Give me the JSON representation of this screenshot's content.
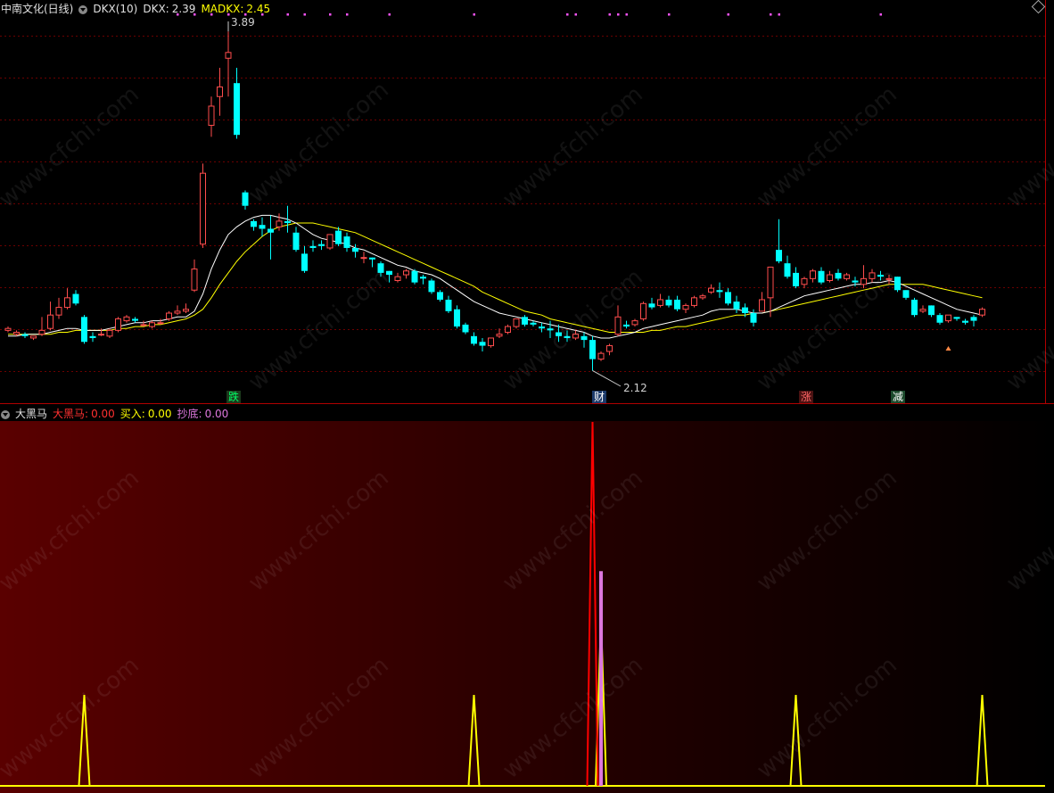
{
  "header": {
    "stock_name": "中南文化(日线)",
    "indicator_name": "DKX(10)",
    "dkx_label": "DKX:",
    "dkx_value": "2.39",
    "madkx_label": "MADKX:",
    "madkx_value": "2.45"
  },
  "price_annotations": {
    "high": "3.89",
    "low": "2.12"
  },
  "signal_tags": {
    "die": "跌",
    "cai": "财",
    "zhang": "涨",
    "jian": "减"
  },
  "sub_header": {
    "indicator_name": "大黑马",
    "dahema_label": "大黑马:",
    "dahema_value": "0.00",
    "mairu_label": "买入:",
    "mairu_value": "0.00",
    "chaodi_label": "抄底:",
    "chaodi_value": "0.00"
  },
  "watermark": "www.cfchi.com",
  "colors": {
    "up": "#ff4d4d",
    "down": "#00ffff",
    "dkx_line": "#ffffff",
    "madkx_line": "#ffff00",
    "dahema": "#ff0000",
    "mairu": "#ffff00",
    "chaodi": "#dd77dd",
    "grid": "#6b0000"
  },
  "chart_data": {
    "type": "candlestick",
    "candles": [
      [
        2.33,
        2.35,
        2.34,
        2.32
      ],
      [
        2.31,
        2.33,
        2.32,
        2.3
      ],
      [
        2.31,
        2.32,
        2.3,
        2.29
      ],
      [
        2.29,
        2.3,
        2.3,
        2.28
      ],
      [
        2.31,
        2.4,
        2.33,
        2.3
      ],
      [
        2.34,
        2.48,
        2.41,
        2.33
      ],
      [
        2.41,
        2.5,
        2.45,
        2.39
      ],
      [
        2.45,
        2.55,
        2.5,
        2.44
      ],
      [
        2.52,
        2.54,
        2.47,
        2.46
      ],
      [
        2.4,
        2.41,
        2.27,
        2.26
      ],
      [
        2.3,
        2.32,
        2.29,
        2.27
      ],
      [
        2.31,
        2.34,
        2.31,
        2.3
      ],
      [
        2.3,
        2.34,
        2.33,
        2.29
      ],
      [
        2.33,
        2.4,
        2.39,
        2.32
      ],
      [
        2.38,
        2.41,
        2.4,
        2.37
      ],
      [
        2.39,
        2.4,
        2.38,
        2.37
      ],
      [
        2.36,
        2.38,
        2.36,
        2.35
      ],
      [
        2.35,
        2.38,
        2.37,
        2.34
      ],
      [
        2.37,
        2.39,
        2.37,
        2.36
      ],
      [
        2.39,
        2.43,
        2.42,
        2.38
      ],
      [
        2.42,
        2.46,
        2.43,
        2.41
      ],
      [
        2.43,
        2.47,
        2.44,
        2.42
      ],
      [
        2.54,
        2.7,
        2.65,
        2.53
      ],
      [
        2.78,
        3.2,
        3.15,
        2.76
      ],
      [
        3.4,
        3.55,
        3.5,
        3.34
      ],
      [
        3.55,
        3.7,
        3.6,
        3.45
      ],
      [
        3.75,
        3.89,
        3.78,
        3.55
      ],
      [
        3.62,
        3.7,
        3.35,
        3.33
      ],
      [
        3.05,
        3.06,
        2.98,
        2.96
      ],
      [
        2.9,
        2.91,
        2.87,
        2.85
      ],
      [
        2.88,
        2.92,
        2.86,
        2.82
      ],
      [
        2.86,
        2.93,
        2.84,
        2.7
      ],
      [
        2.87,
        2.94,
        2.9,
        2.85
      ],
      [
        2.9,
        2.98,
        2.89,
        2.84
      ],
      [
        2.84,
        2.87,
        2.75,
        2.74
      ],
      [
        2.73,
        2.77,
        2.64,
        2.63
      ],
      [
        2.77,
        2.8,
        2.76,
        2.74
      ],
      [
        2.78,
        2.8,
        2.77,
        2.75
      ],
      [
        2.76,
        2.8,
        2.83,
        2.75
      ],
      [
        2.85,
        2.87,
        2.78,
        2.77
      ],
      [
        2.82,
        2.84,
        2.76,
        2.74
      ],
      [
        2.76,
        2.78,
        2.74,
        2.71
      ],
      [
        2.71,
        2.74,
        2.71,
        2.68
      ],
      [
        2.71,
        2.7,
        2.7,
        2.66
      ],
      [
        2.68,
        2.69,
        2.63,
        2.61
      ],
      [
        2.64,
        2.62,
        2.62,
        2.58
      ],
      [
        2.59,
        2.63,
        2.61,
        2.58
      ],
      [
        2.62,
        2.65,
        2.64,
        2.6
      ],
      [
        2.64,
        2.65,
        2.58,
        2.57
      ],
      [
        2.61,
        2.62,
        2.6,
        2.57
      ],
      [
        2.59,
        2.6,
        2.53,
        2.52
      ],
      [
        2.53,
        2.54,
        2.49,
        2.48
      ],
      [
        2.49,
        2.51,
        2.43,
        2.42
      ],
      [
        2.44,
        2.46,
        2.35,
        2.34
      ],
      [
        2.36,
        2.37,
        2.32,
        2.31
      ],
      [
        2.3,
        2.32,
        2.26,
        2.25
      ],
      [
        2.27,
        2.29,
        2.25,
        2.22
      ],
      [
        2.25,
        2.29,
        2.29,
        2.24
      ],
      [
        2.3,
        2.34,
        2.31,
        2.29
      ],
      [
        2.32,
        2.36,
        2.35,
        2.31
      ],
      [
        2.35,
        2.38,
        2.39,
        2.34
      ],
      [
        2.4,
        2.41,
        2.36,
        2.35
      ],
      [
        2.37,
        2.38,
        2.36,
        2.35
      ],
      [
        2.35,
        2.37,
        2.34,
        2.32
      ],
      [
        2.34,
        2.38,
        2.33,
        2.29
      ],
      [
        2.32,
        2.36,
        2.3,
        2.27
      ],
      [
        2.3,
        2.33,
        2.29,
        2.27
      ],
      [
        2.29,
        2.33,
        2.31,
        2.28
      ],
      [
        2.3,
        2.32,
        2.28,
        2.24
      ],
      [
        2.28,
        2.3,
        2.18,
        2.12
      ],
      [
        2.18,
        2.22,
        2.21,
        2.17
      ],
      [
        2.22,
        2.26,
        2.25,
        2.2
      ],
      [
        2.31,
        2.46,
        2.4,
        2.3
      ],
      [
        2.36,
        2.38,
        2.35,
        2.34
      ],
      [
        2.36,
        2.39,
        2.38,
        2.35
      ],
      [
        2.39,
        2.48,
        2.47,
        2.38
      ],
      [
        2.47,
        2.5,
        2.45,
        2.44
      ],
      [
        2.46,
        2.52,
        2.49,
        2.45
      ],
      [
        2.49,
        2.51,
        2.46,
        2.45
      ],
      [
        2.49,
        2.51,
        2.44,
        2.43
      ],
      [
        2.44,
        2.47,
        2.46,
        2.42
      ],
      [
        2.46,
        2.51,
        2.5,
        2.45
      ],
      [
        2.5,
        2.52,
        2.51,
        2.49
      ],
      [
        2.53,
        2.57,
        2.55,
        2.52
      ],
      [
        2.54,
        2.58,
        2.53,
        2.5
      ],
      [
        2.53,
        2.55,
        2.47,
        2.46
      ],
      [
        2.48,
        2.51,
        2.44,
        2.42
      ],
      [
        2.45,
        2.47,
        2.42,
        2.4
      ],
      [
        2.42,
        2.44,
        2.37,
        2.35
      ],
      [
        2.43,
        2.53,
        2.49,
        2.43
      ],
      [
        2.5,
        2.65,
        2.66,
        2.4
      ],
      [
        2.75,
        2.91,
        2.69,
        2.68
      ],
      [
        2.68,
        2.72,
        2.61,
        2.6
      ],
      [
        2.63,
        2.66,
        2.56,
        2.55
      ],
      [
        2.57,
        2.61,
        2.6,
        2.55
      ],
      [
        2.6,
        2.65,
        2.64,
        2.58
      ],
      [
        2.64,
        2.66,
        2.58,
        2.57
      ],
      [
        2.59,
        2.64,
        2.62,
        2.58
      ],
      [
        2.63,
        2.65,
        2.6,
        2.59
      ],
      [
        2.6,
        2.63,
        2.62,
        2.59
      ],
      [
        2.59,
        2.61,
        2.58,
        2.56
      ],
      [
        2.57,
        2.67,
        2.6,
        2.55
      ],
      [
        2.6,
        2.65,
        2.63,
        2.58
      ],
      [
        2.62,
        2.64,
        2.61,
        2.59
      ],
      [
        2.6,
        2.62,
        2.6,
        2.57
      ],
      [
        2.61,
        2.58,
        2.54,
        2.53
      ],
      [
        2.54,
        2.53,
        2.5,
        2.49
      ],
      [
        2.49,
        2.5,
        2.41,
        2.4
      ],
      [
        2.43,
        2.46,
        2.44,
        2.42
      ],
      [
        2.46,
        2.45,
        2.41,
        2.4
      ],
      [
        2.41,
        2.42,
        2.37,
        2.36
      ],
      [
        2.38,
        2.4,
        2.41,
        2.37
      ],
      [
        2.4,
        2.4,
        2.39,
        2.38
      ],
      [
        2.38,
        2.39,
        2.37,
        2.36
      ],
      [
        2.4,
        2.41,
        2.38,
        2.35
      ],
      [
        2.41,
        2.45,
        2.44,
        2.4
      ]
    ],
    "dkx": [
      2.3,
      2.3,
      2.31,
      2.31,
      2.31,
      2.32,
      2.33,
      2.34,
      2.34,
      2.33,
      2.33,
      2.33,
      2.34,
      2.35,
      2.36,
      2.37,
      2.37,
      2.38,
      2.38,
      2.39,
      2.4,
      2.4,
      2.43,
      2.52,
      2.65,
      2.75,
      2.83,
      2.87,
      2.9,
      2.92,
      2.93,
      2.93,
      2.92,
      2.91,
      2.89,
      2.86,
      2.83,
      2.81,
      2.8,
      2.79,
      2.78,
      2.76,
      2.75,
      2.73,
      2.71,
      2.69,
      2.67,
      2.66,
      2.64,
      2.63,
      2.62,
      2.6,
      2.57,
      2.54,
      2.51,
      2.48,
      2.46,
      2.44,
      2.42,
      2.41,
      2.4,
      2.39,
      2.38,
      2.37,
      2.36,
      2.35,
      2.34,
      2.33,
      2.32,
      2.3,
      2.29,
      2.29,
      2.3,
      2.31,
      2.32,
      2.34,
      2.35,
      2.36,
      2.37,
      2.38,
      2.39,
      2.4,
      2.41,
      2.43,
      2.44,
      2.44,
      2.44,
      2.43,
      2.42,
      2.42,
      2.43,
      2.45,
      2.47,
      2.49,
      2.51,
      2.52,
      2.53,
      2.54,
      2.55,
      2.56,
      2.57,
      2.57,
      2.58,
      2.58,
      2.59,
      2.58,
      2.56,
      2.54,
      2.52,
      2.5,
      2.48,
      2.46,
      2.44,
      2.43,
      2.42,
      2.41
    ],
    "madkx": [
      2.31,
      2.31,
      2.31,
      2.31,
      2.31,
      2.31,
      2.32,
      2.32,
      2.33,
      2.33,
      2.33,
      2.33,
      2.33,
      2.34,
      2.34,
      2.35,
      2.35,
      2.36,
      2.36,
      2.37,
      2.38,
      2.39,
      2.41,
      2.44,
      2.5,
      2.57,
      2.63,
      2.69,
      2.74,
      2.78,
      2.82,
      2.85,
      2.87,
      2.88,
      2.89,
      2.89,
      2.89,
      2.88,
      2.87,
      2.86,
      2.85,
      2.84,
      2.82,
      2.8,
      2.78,
      2.76,
      2.74,
      2.72,
      2.7,
      2.68,
      2.66,
      2.64,
      2.62,
      2.6,
      2.58,
      2.56,
      2.53,
      2.51,
      2.49,
      2.47,
      2.45,
      2.43,
      2.42,
      2.41,
      2.39,
      2.38,
      2.37,
      2.36,
      2.35,
      2.34,
      2.33,
      2.32,
      2.32,
      2.32,
      2.32,
      2.32,
      2.33,
      2.33,
      2.34,
      2.35,
      2.35,
      2.36,
      2.37,
      2.38,
      2.39,
      2.4,
      2.41,
      2.41,
      2.42,
      2.42,
      2.43,
      2.44,
      2.45,
      2.46,
      2.47,
      2.48,
      2.49,
      2.5,
      2.51,
      2.52,
      2.53,
      2.54,
      2.55,
      2.56,
      2.57,
      2.57,
      2.57,
      2.57,
      2.57,
      2.56,
      2.55,
      2.54,
      2.53,
      2.52,
      2.51,
      2.5
    ],
    "madkx_dots": [
      20,
      22,
      24,
      26,
      28,
      30,
      33,
      35,
      38,
      40,
      45,
      55,
      66,
      67,
      71,
      72,
      73,
      78,
      85,
      90,
      91,
      103
    ],
    "price_range": [
      1.95,
      3.97
    ],
    "sub_series": {
      "dahema": {
        "name": "大黑马",
        "peaks": [
          {
            "i": 69,
            "v": 1.0
          }
        ]
      },
      "mairu": {
        "name": "买入",
        "peaks": [
          {
            "i": 9,
            "v": 0.25
          },
          {
            "i": 55,
            "v": 0.25
          },
          {
            "i": 70,
            "v": 0.46
          },
          {
            "i": 93,
            "v": 0.25
          },
          {
            "i": 115,
            "v": 0.25
          }
        ]
      },
      "chaodi": {
        "name": "抄底",
        "peaks": [
          {
            "i": 70,
            "v": 0.59
          }
        ]
      }
    }
  }
}
